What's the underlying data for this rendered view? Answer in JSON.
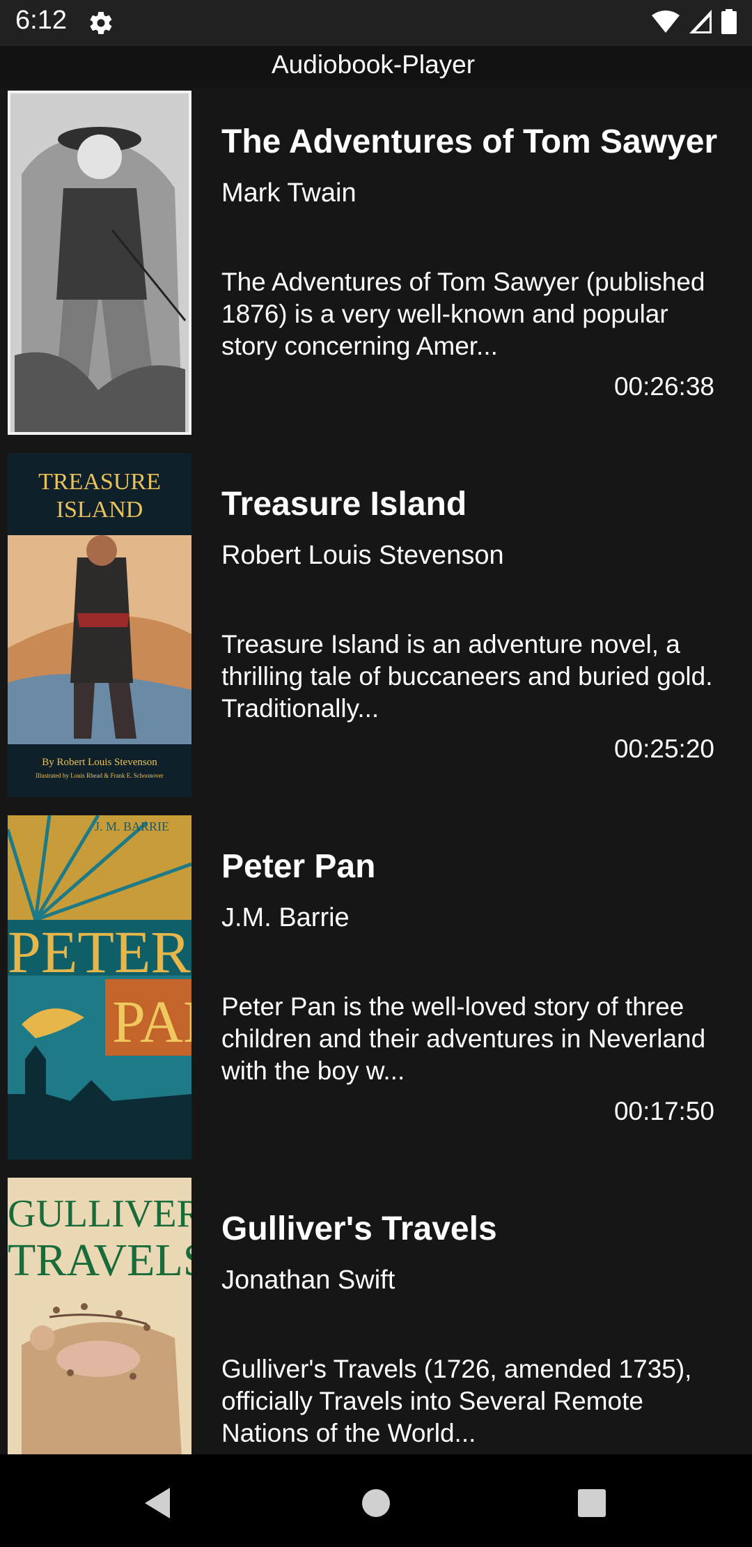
{
  "status_bar": {
    "time": "6:12",
    "icons": [
      "gear-icon",
      "wifi-icon",
      "signal-icon",
      "battery-icon"
    ]
  },
  "app": {
    "title": "Audiobook-Player"
  },
  "books": [
    {
      "title": "The Adventures of Tom Sawyer",
      "author": "Mark Twain",
      "description": "The Adventures of Tom Sawyer (published 1876) is a very well-known and popular story concerning Amer...",
      "duration": "00:26:38",
      "cover_text": ""
    },
    {
      "title": "Treasure Island",
      "author": "Robert Louis Stevenson",
      "description": "Treasure Island is an adventure novel, a thrilling tale of buccaneers and buried gold. Traditionally...",
      "duration": "00:25:20",
      "cover_text": "TREASURE ISLAND",
      "cover_byline": "By Robert Louis Stevenson",
      "cover_credit": "Illustrated by Louis Rhead & Frank E. Schoonover"
    },
    {
      "title": "Peter Pan",
      "author": "J.M. Barrie",
      "description": "Peter Pan is the well-loved story of three children and their adventures in Neverland with the boy w...",
      "duration": "00:17:50",
      "cover_text": "PETER PAN",
      "cover_byline": "J. M. BARRIE"
    },
    {
      "title": "Gulliver's Travels",
      "author": "Jonathan Swift",
      "description": "Gulliver's Travels (1726, amended 1735), officially Travels into Several Remote Nations of the World...",
      "duration": "",
      "cover_text": "GULLIVER'S TRAVELS"
    }
  ],
  "nav_bar": {
    "icons": [
      "back-icon",
      "home-icon",
      "recents-icon"
    ]
  },
  "colors": {
    "background": "#121212",
    "status_bar": "#212121",
    "nav_bar": "#000000",
    "text": "#ffffff"
  }
}
